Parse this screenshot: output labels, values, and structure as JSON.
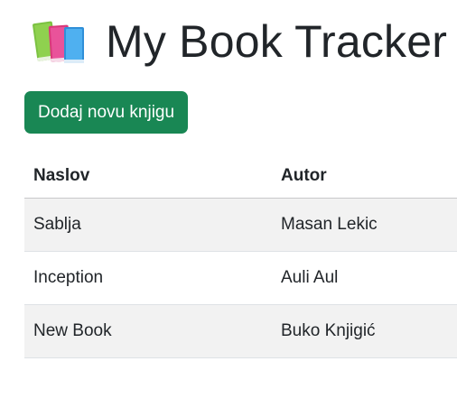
{
  "header": {
    "icon": "books-icon",
    "title": "My Book Tracker"
  },
  "toolbar": {
    "add_button_label": "Dodaj novu knjigu"
  },
  "colors": {
    "accent": "#198754",
    "stripe": "#f2f2f2",
    "text": "#212529"
  },
  "table": {
    "columns": [
      "Naslov",
      "Autor"
    ],
    "rows": [
      {
        "title": "Sablja",
        "author": "Masan Lekic"
      },
      {
        "title": "Inception",
        "author": "Auli Aul"
      },
      {
        "title": "New Book",
        "author": "Buko Knjigić"
      }
    ]
  }
}
